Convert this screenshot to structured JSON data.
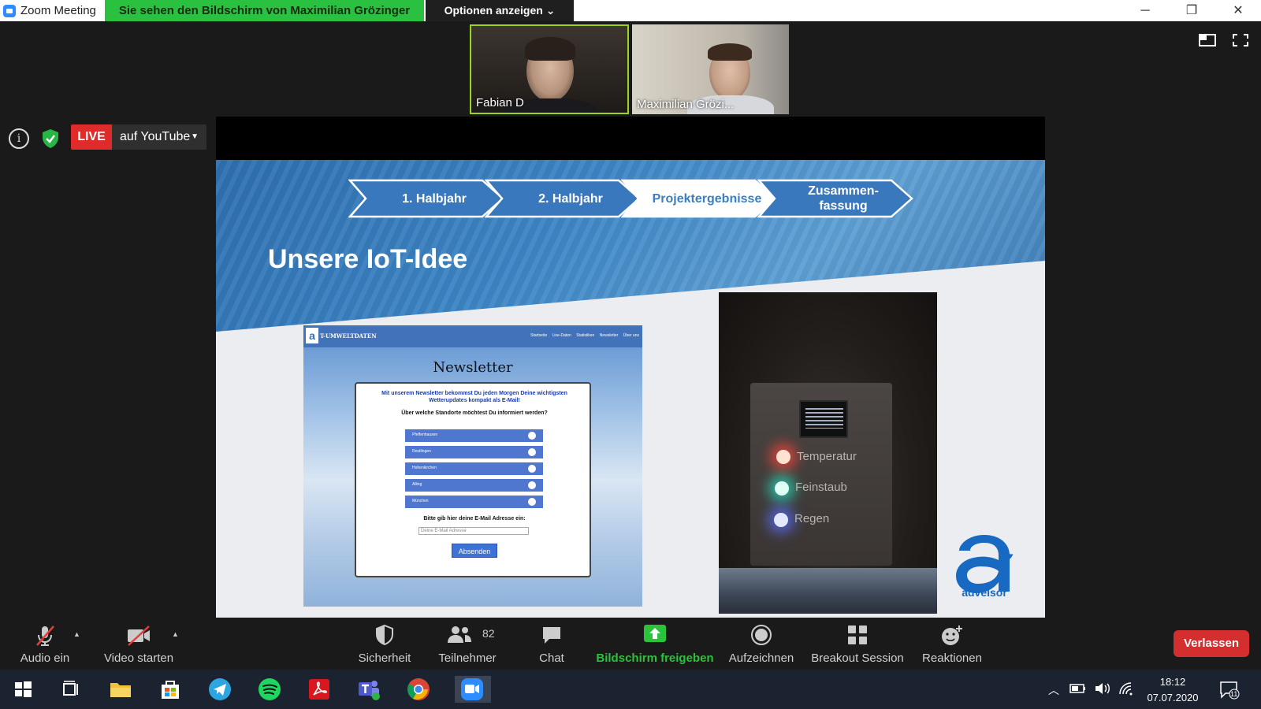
{
  "window": {
    "title": "Zoom Meeting",
    "share_banner": "Sie sehen den Bildschirm von Maximilian Grözinger",
    "options_label": "Optionen anzeigen"
  },
  "participants": [
    {
      "name": "Fabian D"
    },
    {
      "name": "Maximilian Grözi..."
    }
  ],
  "live": {
    "badge": "LIVE",
    "platform": "auf YouTube"
  },
  "slide": {
    "steps": [
      "1. Halbjahr",
      "2. Halbjahr",
      "Projektergebnisse",
      "Zusammen-\nfassung"
    ],
    "active_step": 2,
    "title": "Unsere IoT-Idee",
    "logo_text": "adveisor",
    "newsletter": {
      "brand": "T-UMWELTDATEN",
      "nav": [
        "Startseite",
        "Live-Daten",
        "Statistiken",
        "Newsletter",
        "Über uns"
      ],
      "heading": "Newsletter",
      "intro": "Mit unserem Newsletter bekommst Du jeden Morgen Deine wichtigsten Wetterupdates kompakt als E-Mail!",
      "question": "Über welche Standorte möchtest Du informiert werden?",
      "options": [
        "Pfeffenhausen",
        "Reutlingen",
        "Hohenkirchen",
        "Alling",
        "München"
      ],
      "email_label": "Bitte gib hier deine E-Mail Adresse ein:",
      "email_placeholder": "Deine E-Mail Adresse",
      "submit": "Absenden"
    },
    "device": {
      "labels": [
        "Temperatur",
        "Feinstaub",
        "Regen"
      ]
    }
  },
  "toolbar": {
    "audio": "Audio ein",
    "video": "Video starten",
    "security": "Sicherheit",
    "participants": "Teilnehmer",
    "participant_count": "82",
    "chat": "Chat",
    "share": "Bildschirm freigeben",
    "record": "Aufzeichnen",
    "breakout": "Breakout Session",
    "reactions": "Reaktionen",
    "leave": "Verlassen"
  },
  "taskbar": {
    "time": "18:12",
    "date": "07.07.2020",
    "notification_count": "11"
  },
  "colors": {
    "share_green": "#29c13f",
    "live_red": "#e02b2b",
    "leave_red": "#d42e2e",
    "slide_blue": "#3d86c6"
  }
}
